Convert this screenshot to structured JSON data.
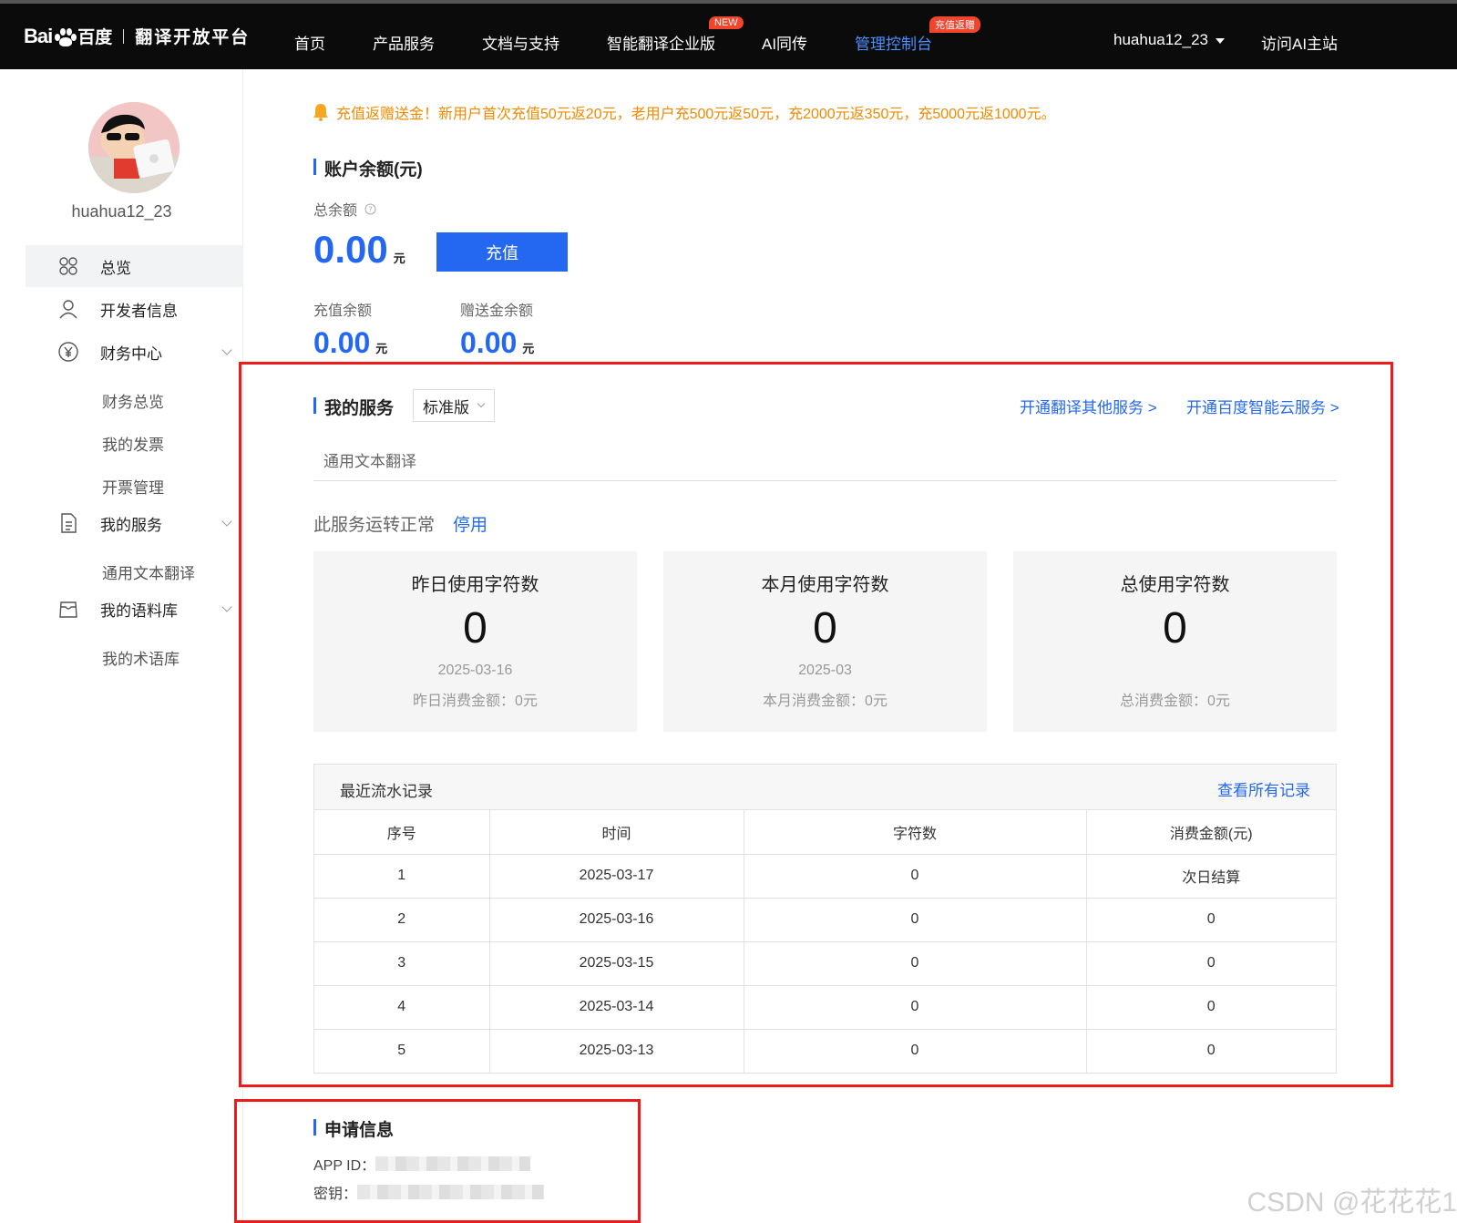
{
  "header": {
    "logo_text": "Bai",
    "logo_text2": "百度",
    "platform": "翻译开放平台",
    "nav": [
      {
        "label": "首页"
      },
      {
        "label": "产品服务"
      },
      {
        "label": "文档与支持"
      },
      {
        "label": "智能翻译企业版",
        "badge": "NEW"
      },
      {
        "label": "AI同传"
      },
      {
        "label": "管理控制台",
        "badge": "充值返赠",
        "active": true
      }
    ],
    "username": "huahua12_23",
    "visit_ai": "访问AI主站"
  },
  "sidebar": {
    "username": "huahua12_23",
    "items": [
      {
        "label": "总览",
        "icon": "grid-icon",
        "active": true
      },
      {
        "label": "开发者信息",
        "icon": "user-icon"
      },
      {
        "label": "财务中心",
        "icon": "yen-icon",
        "expandable": true
      },
      {
        "label": "我的服务",
        "icon": "document-icon",
        "expandable": true
      },
      {
        "label": "我的语料库",
        "icon": "box-icon",
        "expandable": true
      }
    ],
    "finance_sub": [
      "财务总览",
      "我的发票",
      "开票管理"
    ],
    "service_sub": [
      "通用文本翻译"
    ],
    "corpus_sub": [
      "我的术语库"
    ]
  },
  "notice": "充值返赠送金！新用户首次充值50元返20元，老用户充500元返50元，充2000元返350元，充5000元返1000元。",
  "account": {
    "title": "账户余额(元)",
    "total_label": "总余额",
    "total_value": "0.00",
    "unit": "元",
    "recharge_button": "充值",
    "recharge_balance_label": "充值余额",
    "recharge_balance_value": "0.00",
    "gift_balance_label": "赠送金余额",
    "gift_balance_value": "0.00"
  },
  "services": {
    "title": "我的服务",
    "edition": "标准版",
    "link_other": "开通翻译其他服务 >",
    "link_cloud": "开通百度智能云服务 >",
    "tab": "通用文本翻译",
    "status_text": "此服务运转正常",
    "disable_link": "停用",
    "stats": [
      {
        "title": "昨日使用字符数",
        "value": "0",
        "date": "2025-03-16",
        "fee": "昨日消费金额：0元"
      },
      {
        "title": "本月使用字符数",
        "value": "0",
        "date": "2025-03",
        "fee": "本月消费金额：0元"
      },
      {
        "title": "总使用字符数",
        "value": "0",
        "date": "",
        "fee": "总消费金额：0元"
      }
    ]
  },
  "records": {
    "title": "最近流水记录",
    "view_all": "查看所有记录",
    "columns": [
      "序号",
      "时间",
      "字符数",
      "消费金额(元)"
    ],
    "rows": [
      [
        "1",
        "2025-03-17",
        "0",
        "次日结算"
      ],
      [
        "2",
        "2025-03-16",
        "0",
        "0"
      ],
      [
        "3",
        "2025-03-15",
        "0",
        "0"
      ],
      [
        "4",
        "2025-03-14",
        "0",
        "0"
      ],
      [
        "5",
        "2025-03-13",
        "0",
        "0"
      ]
    ]
  },
  "application": {
    "title": "申请信息",
    "app_id_label": "APP ID：",
    "secret_label": "密钥："
  },
  "watermark": "CSDN @花花花1",
  "colors": {
    "accent": "#2468f2",
    "notice": "#f08a00",
    "highlight_box": "#ee1b1b",
    "badge": "#f2452e"
  }
}
